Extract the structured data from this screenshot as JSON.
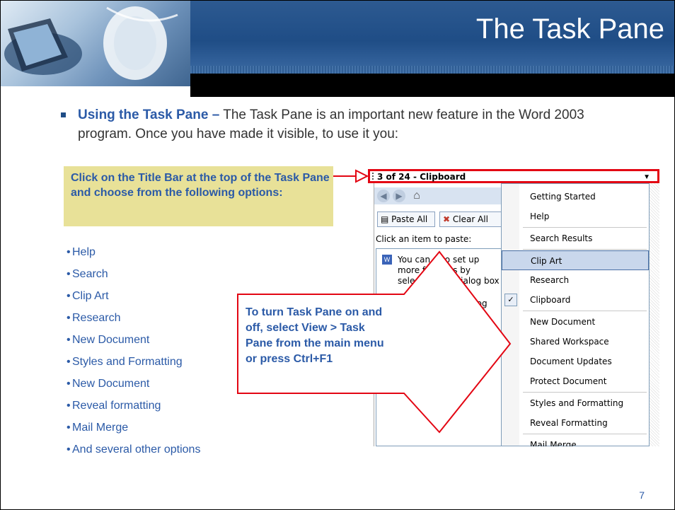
{
  "slide": {
    "title": "The Task Pane",
    "page_number": "7"
  },
  "intro": {
    "lead": "Using the Task Pane –",
    "text": " The Task Pane is an important new feature in the Word 2003 program. Once you have made it visible, to use it you:"
  },
  "callout": {
    "text": "Click on the Title Bar at the top of the Task Pane and choose from the following options:"
  },
  "options": [
    "Help",
    "Search",
    "Clip Art",
    "Research",
    "New Document",
    "Styles and Formatting",
    "New Document",
    "Reveal formatting",
    "Mail Merge",
    "And several other options"
  ],
  "turn_callout": {
    "text": "To turn Task Pane on and off, select View > Task Pane from the main menu or press Ctrl+F1"
  },
  "task_pane": {
    "title": "3 of 24 - Clipboard",
    "paste_all": "Paste All",
    "clear_all": "Clear All",
    "hint": "Click an item to paste:",
    "clip_item_text": "You can also set up more features by selecting the dialog box",
    "clip_item_text2": "dialog",
    "menu_items": [
      {
        "label": "Getting Started",
        "highlighted": false,
        "checked": false
      },
      {
        "label": "Help",
        "highlighted": false,
        "checked": false
      },
      {
        "label": "Search Results",
        "highlighted": false,
        "checked": false
      },
      {
        "label": "Clip Art",
        "highlighted": true,
        "checked": false
      },
      {
        "label": "Research",
        "highlighted": false,
        "checked": false
      },
      {
        "label": "Clipboard",
        "highlighted": false,
        "checked": true
      },
      {
        "label": "New Document",
        "highlighted": false,
        "checked": false
      },
      {
        "label": "Shared Workspace",
        "highlighted": false,
        "checked": false
      },
      {
        "label": "Document Updates",
        "highlighted": false,
        "checked": false
      },
      {
        "label": "Protect Document",
        "highlighted": false,
        "checked": false
      },
      {
        "label": "Styles and Formatting",
        "highlighted": false,
        "checked": false
      },
      {
        "label": "Reveal Formatting",
        "highlighted": false,
        "checked": false
      },
      {
        "label": "Mail Merge",
        "highlighted": false,
        "checked": false
      }
    ]
  },
  "colors": {
    "title_band": "#1f4d86",
    "body_text": "#2b5aa7",
    "callout_bg": "#e8e198",
    "arrow_red": "#e30613"
  }
}
